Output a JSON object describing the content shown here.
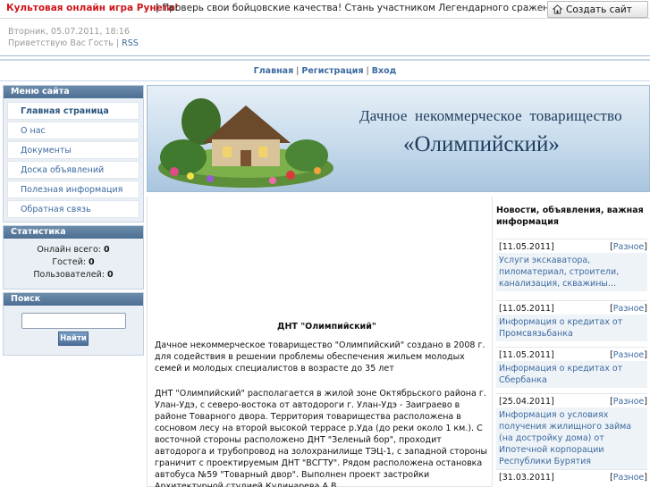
{
  "topbar": {
    "ad_highlight": "Культовая онлайн игра Рунета!",
    "ad_text": "[ Проверь свои бойцовские качества! Стань участником Легендарного сражения! ]",
    "create_site_button": "Создать сайт",
    "create_site_icon": "house-icon"
  },
  "meta": {
    "date": "Вторник, 05.07.2011, 18:16",
    "greeting": "Приветствую Вас Гость",
    "separator": "|",
    "rss": "RSS"
  },
  "nav": {
    "items": [
      "Главная",
      "Регистрация",
      "Вход"
    ],
    "separator": "|"
  },
  "sidebar": {
    "menu_title": "Меню сайта",
    "menu_items": [
      {
        "label": "Главная страница",
        "active": true
      },
      {
        "label": "О нас",
        "active": false
      },
      {
        "label": "Документы",
        "active": false
      },
      {
        "label": "Доска объявлений",
        "active": false
      },
      {
        "label": "Полезная информация",
        "active": false
      },
      {
        "label": "Обратная связь",
        "active": false
      }
    ],
    "stats_title": "Статистика",
    "stats": [
      {
        "label": "Онлайн всего:",
        "value": "0"
      },
      {
        "label": "Гостей:",
        "value": "0"
      },
      {
        "label": "Пользователей:",
        "value": "0"
      }
    ],
    "search_title": "Поиск",
    "search_button": "Найти"
  },
  "banner": {
    "line1": "Дачное некоммерческое товарищество",
    "line2": "«Олимпийский»"
  },
  "content": {
    "title": "ДНТ \"Олимпийский\"",
    "p1": "Дачное некоммерческое товарищество \"Олимпийский\" создано в 2008 г. для содействия в решении проблемы обеспечения жильем молодых семей и молодых специалистов в возрасте до 35 лет",
    "p2": "ДНТ \"Олимпийский\" располагается в жилой зоне Октябрьского района г. Улан-Удэ, с северо-востока от автодороги г. Улан-Удэ - Заиграево в районе Товарного двора. Территория товарищества расположена в сосновом лесу на второй высокой террасе р.Уда (до реки около 1 км.). С восточной стороны расположено ДНТ \"Зеленый бор\", проходит автодорога и трубопровод на золохранилище ТЭЦ-1, с западной стороны граничит с проектируемым ДНТ \"ВСГТУ\". Рядом расположена остановка автобуса №59 \"Товарный двор\". Выполнен проект застройки Архитектурной студией Кудинарева А.В."
  },
  "news": {
    "title": "Новости, объявления, важная информация",
    "items": [
      {
        "date": "[11.05.2011]",
        "cat_open": "[",
        "category": "Разное",
        "cat_close": "]",
        "text": "Услуги экскаватора, пиломатериал, строители, канализация, скважины..."
      },
      {
        "date": "[11.05.2011]",
        "cat_open": "[",
        "category": "Разное",
        "cat_close": "]",
        "text": "Информация о кредитах от Промсвязьбанка"
      },
      {
        "date": "[11.05.2011]",
        "cat_open": "[",
        "category": "Разное",
        "cat_close": "]",
        "text": "Информация о кредитах от Сбербанка"
      },
      {
        "date": "[25.04.2011]",
        "cat_open": "[",
        "category": "Разное",
        "cat_close": "]",
        "text": "Информация о условиях получения жилищного займа (на достройку дома) от Ипотечной корпорации Республики Бурятия"
      },
      {
        "date": "[31.03.2011]",
        "cat_open": "[",
        "category": "Разное",
        "cat_close": "]",
        "text": ""
      }
    ]
  },
  "colors": {
    "ad_red": "#d0161a",
    "link_blue": "#3c6aa0",
    "box_header": "#5a7ca0"
  }
}
